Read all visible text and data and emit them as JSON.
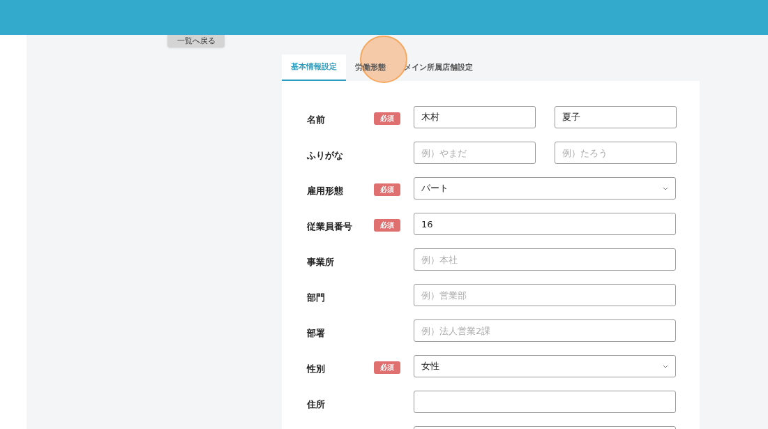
{
  "back_button": "一覧へ戻る",
  "tabs": [
    {
      "label": "基本情報設定",
      "selected": true
    },
    {
      "label": "労働形態",
      "selected": false
    },
    {
      "label": "メイン所属店舗設定",
      "selected": false
    }
  ],
  "fields": [
    {
      "kind": "pair",
      "label": "名前",
      "badge": "必須",
      "inputs": [
        {
          "value": "木村"
        },
        {
          "value": "夏子"
        }
      ]
    },
    {
      "kind": "pair",
      "label": "ふりがな",
      "inputs": [
        {
          "placeholder": "例）やまだ"
        },
        {
          "placeholder": "例）たろう"
        }
      ]
    },
    {
      "kind": "select",
      "label": "雇用形態",
      "badge": "必須",
      "value": "パート"
    },
    {
      "kind": "text",
      "label": "従業員番号",
      "badge": "必須",
      "value": "16"
    },
    {
      "kind": "text",
      "label": "事業所",
      "placeholder": "例）本社"
    },
    {
      "kind": "text",
      "label": "部門",
      "placeholder": "例）営業部"
    },
    {
      "kind": "text",
      "label": "部署",
      "placeholder": "例）法人営業2課"
    },
    {
      "kind": "select",
      "label": "性別",
      "badge": "必須",
      "value": "女性"
    },
    {
      "kind": "text",
      "label": "住所"
    },
    {
      "kind": "text"
    }
  ]
}
